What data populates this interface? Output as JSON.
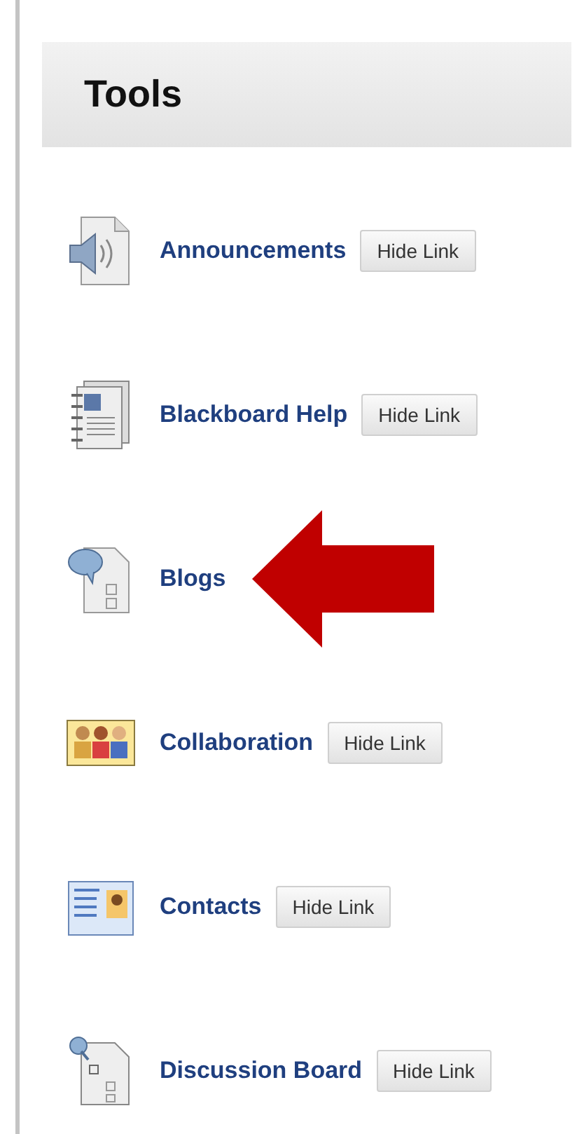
{
  "header": {
    "title": "Tools"
  },
  "tools": [
    {
      "name": "Announcements",
      "button": "Hide Link",
      "pointed": false
    },
    {
      "name": "Blackboard Help",
      "button": "Hide Link",
      "pointed": false
    },
    {
      "name": "Blogs",
      "pointed": true
    },
    {
      "name": "Collaboration",
      "button": "Hide Link",
      "pointed": false
    },
    {
      "name": "Contacts",
      "button": "Hide Link",
      "pointed": false
    },
    {
      "name": "Discussion Board",
      "button": "Hide Link",
      "pointed": false
    }
  ]
}
